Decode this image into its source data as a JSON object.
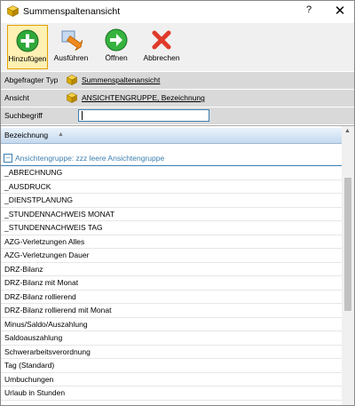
{
  "window": {
    "title": "Summenspaltenansicht",
    "help_label": "?",
    "close_label": "✕"
  },
  "toolbar": {
    "buttons": [
      {
        "label": "Hinzufügen",
        "icon": "add-icon"
      },
      {
        "label": "Ausführen",
        "icon": "execute-icon"
      },
      {
        "label": "Öffnen",
        "icon": "open-icon"
      },
      {
        "label": "Abbrechen",
        "icon": "cancel-icon"
      }
    ]
  },
  "fields": {
    "abgefragter_typ": {
      "label": "Abgefragter Typ",
      "value": "Summenspaltenansicht"
    },
    "ansicht": {
      "label": "Ansicht",
      "value": "ANSICHTENGRUPPE, Bezeichnung"
    },
    "suchbegriff": {
      "label": "Suchbegriff",
      "value": ""
    }
  },
  "list": {
    "column_header": "Bezeichnung",
    "sort_indicator": "▲",
    "group_label": "Ansichtengruppe: zzz leere Ansichtengruppe",
    "group_toggle": "−",
    "items": [
      "_ABRECHNUNG",
      "_AUSDRUCK",
      "_DIENSTPLANUNG",
      "_STUNDENNACHWEIS MONAT",
      "_STUNDENNACHWEIS TAG",
      "AZG-Verletzungen Alles",
      "AZG-Verletzungen Dauer",
      "DRZ-Bilanz",
      "DRZ-Bilanz mit Monat",
      "DRZ-Bilanz rollierend",
      "DRZ-Bilanz rollierend mit Monat",
      "Minus/Saldo/Auszahlung",
      "Saldoauszahlung",
      "Schwerarbeitsverordnung",
      "Tag (Standard)",
      "Umbuchungen",
      "Urlaub in Stunden"
    ]
  },
  "colors": {
    "accent": "#3c7fb1",
    "active_button": "#fff0b3",
    "field_bg": "#d9d9d9"
  }
}
